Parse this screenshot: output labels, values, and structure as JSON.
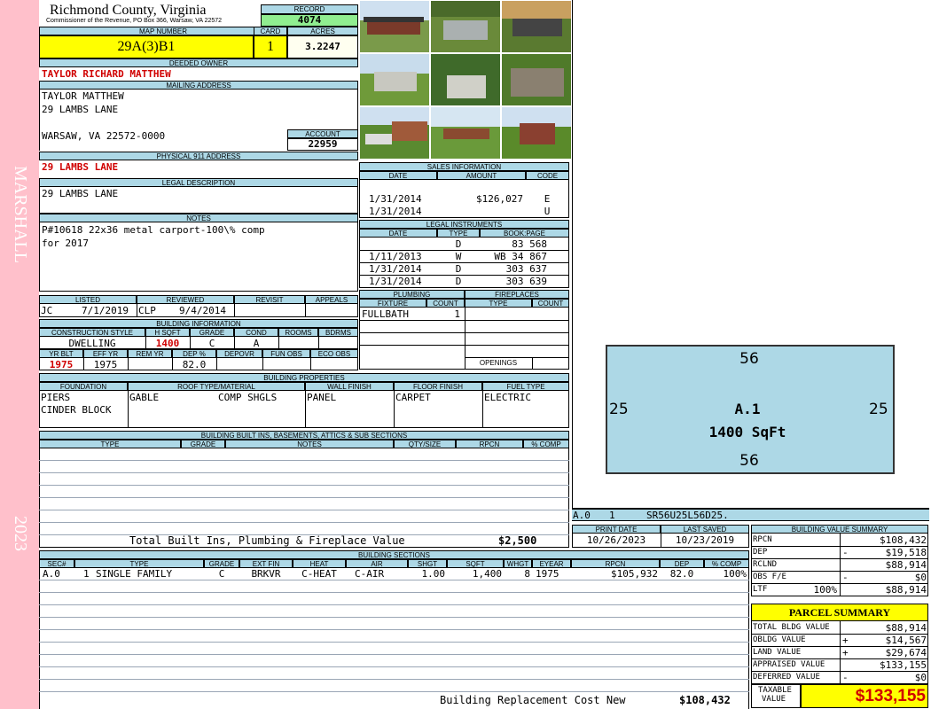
{
  "side": {
    "name": "MARSHALL",
    "year": "2023"
  },
  "header": {
    "county": "Richmond County, Virginia",
    "commissioner": "Commissioner of the Revenue, PO Box 366, Warsaw, VA 22572"
  },
  "record": {
    "label": "RECORD",
    "value": "4074"
  },
  "map": {
    "label": "MAP NUMBER",
    "value": "29A(3)B1"
  },
  "card": {
    "label": "CARD",
    "value": "1"
  },
  "acres": {
    "label": "ACRES",
    "value": "3.2247"
  },
  "deeded_owner": {
    "label": "DEEDED OWNER",
    "value": "TAYLOR RICHARD MATTHEW"
  },
  "mailing": {
    "label": "MAILING ADDRESS",
    "line1": "TAYLOR MATTHEW",
    "line2": "29 LAMBS LANE",
    "line3": "WARSAW, VA 22572-0000"
  },
  "account": {
    "label": "ACCOUNT",
    "value": "22959"
  },
  "physical": {
    "label": "PHYSICAL 911 ADDRESS",
    "value": "29 LAMBS LANE"
  },
  "legal": {
    "label": "LEGAL DESCRIPTION",
    "value": "29 LAMBS LANE"
  },
  "notes": {
    "label": "NOTES",
    "line1": "P#10618 22x36 metal carport-100\\% comp",
    "line2": "for 2017"
  },
  "listed": {
    "label_listed": "LISTED",
    "label_reviewed": "REVIEWED",
    "label_revisit": "REVISIT",
    "label_appeals": "APPEALS",
    "listed_by": "JC",
    "listed_date": "7/1/2019",
    "reviewed_by": "CLP",
    "reviewed_date": "9/4/2014"
  },
  "building_info": {
    "label": "BUILDING INFORMATION",
    "h_style": "CONSTRUCTION STYLE",
    "h_hsqft": "H SQFT",
    "h_grade": "GRADE",
    "h_cond": "COND",
    "h_rooms": "ROOMS",
    "h_bdrms": "BDRMS",
    "style": "DWELLING",
    "hsqft": "1400",
    "grade": "C",
    "cond": "A",
    "h_yrblt": "YR BLT",
    "h_effyr": "EFF YR",
    "h_remyr": "REM YR",
    "h_dep": "DEP %",
    "h_depovr": "DEPOVR",
    "h_funobs": "FUN OBS",
    "h_ecoobs": "ECO OBS",
    "yrblt": "1975",
    "effyr": "1975",
    "dep": "82.0"
  },
  "sales": {
    "label": "SALES INFORMATION",
    "h_date": "DATE",
    "h_amount": "AMOUNT",
    "h_code": "CODE",
    "rows": [
      {
        "date": "1/31/2014",
        "amount": "$126,027",
        "code": "E"
      },
      {
        "date": "1/31/2014",
        "amount": "",
        "code": "U"
      }
    ]
  },
  "legal_instruments": {
    "label": "LEGAL INSTRUMENTS",
    "h_date": "DATE",
    "h_type": "TYPE",
    "h_book": "BOOK:PAGE",
    "rows": [
      {
        "date": "",
        "type": "D",
        "book": "83 568"
      },
      {
        "date": "1/11/2013",
        "type": "W",
        "book": "WB 34 867"
      },
      {
        "date": "1/31/2014",
        "type": "D",
        "book": "303 637"
      },
      {
        "date": "1/31/2014",
        "type": "D",
        "book": "303 639"
      }
    ]
  },
  "plumbing": {
    "label": "PLUMBING",
    "h_fixture": "FIXTURE",
    "h_count": "COUNT",
    "fixture": "FULLBATH",
    "count": "1"
  },
  "fireplaces": {
    "label": "FIREPLACES",
    "h_type": "TYPE",
    "h_count": "COUNT",
    "openings": "OPENINGS"
  },
  "properties": {
    "label": "BUILDING PROPERTIES",
    "h_foundation": "FOUNDATION",
    "h_roof": "ROOF TYPE/MATERIAL",
    "h_wall": "WALL FINISH",
    "h_floor": "FLOOR FINISH",
    "h_fuel": "FUEL TYPE",
    "foundation1": "PIERS",
    "foundation2": "CINDER BLOCK",
    "roof_type": "GABLE",
    "roof_mat": "COMP SHGLS",
    "wall": "PANEL",
    "floor": "CARPET",
    "fuel": "ELECTRIC"
  },
  "builtins": {
    "label": "BUILDING BUILT INS, BASEMENTS, ATTICS & SUB SECTIONS",
    "h_type": "TYPE",
    "h_grade": "GRADE",
    "h_notes": "NOTES",
    "h_qty": "QTY/SIZE",
    "h_rpcn": "RPCN",
    "h_comp": "% COMP",
    "total_label": "Total Built Ins, Plumbing & Fireplace Value",
    "total_value": "$2,500"
  },
  "sketch": {
    "top": "56",
    "bottom": "56",
    "left": "25",
    "right": "25",
    "area_label": "A.1",
    "sqft": "1400 SqFt",
    "footer_sec": "A.0",
    "footer_num": "1",
    "footer_vec": "SR56U25L56D25."
  },
  "dates": {
    "print_label": "PRINT DATE",
    "saved_label": "LAST SAVED",
    "print": "10/26/2023",
    "saved": "10/23/2019"
  },
  "sections": {
    "label": "BUILDING SECTIONS",
    "h_sec": "SEC#",
    "h_type": "TYPE",
    "h_grade": "GRADE",
    "h_ext": "EXT FIN",
    "h_heat": "HEAT",
    "h_air": "AIR",
    "h_shgt": "SHGT",
    "h_sqft": "SQFT",
    "h_whgt": "WHGT",
    "h_eyear": "EYEAR",
    "h_rpcn": "RPCN",
    "h_dep": "DEP",
    "h_comp": "% COMP",
    "row": {
      "sec": "A.0",
      "num": "1",
      "type": "SINGLE FAMILY",
      "grade": "C",
      "ext": "BRKVR",
      "heat": "C-HEAT",
      "air": "C-AIR",
      "shgt": "1.00",
      "sqft": "1,400",
      "whgt": "8",
      "eyear": "1975",
      "rpcn": "$105,932",
      "dep": "82.0",
      "comp": "100%"
    },
    "brcn_label": "Building Replacement Cost New",
    "brcn_value": "$108,432"
  },
  "value_summary": {
    "label": "BUILDING VALUE SUMMARY",
    "rows": [
      {
        "k": "RPCN",
        "s": "",
        "v": "$108,432"
      },
      {
        "k": "DEP",
        "s": "-",
        "v": "$19,518"
      },
      {
        "k": "RCLND",
        "s": "",
        "v": "$88,914"
      },
      {
        "k": "OBS F/E",
        "s": "-",
        "v": "$0"
      },
      {
        "k": "LTF",
        "s": "100%",
        "v": "$88,914"
      }
    ]
  },
  "parcel": {
    "label": "PARCEL SUMMARY",
    "rows": [
      {
        "k": "TOTAL BLDG VALUE",
        "s": "",
        "v": "$88,914"
      },
      {
        "k": "OBLDG VALUE",
        "s": "+",
        "v": "$14,567"
      },
      {
        "k": "LAND VALUE",
        "s": "+",
        "v": "$29,674"
      },
      {
        "k": "APPRAISED VALUE",
        "s": "",
        "v": "$133,155"
      },
      {
        "k": "DEFERRED VALUE",
        "s": "-",
        "v": "$0"
      }
    ],
    "taxable_label1": "TAXABLE",
    "taxable_label2": "VALUE",
    "taxable_value": "$133,155"
  },
  "colors": {
    "header_blue": "#add8e6",
    "highlight_yellow": "#ffff00",
    "record_green": "#90ee90",
    "side_pink": "#ffc0cb",
    "value_red": "#d00000"
  }
}
